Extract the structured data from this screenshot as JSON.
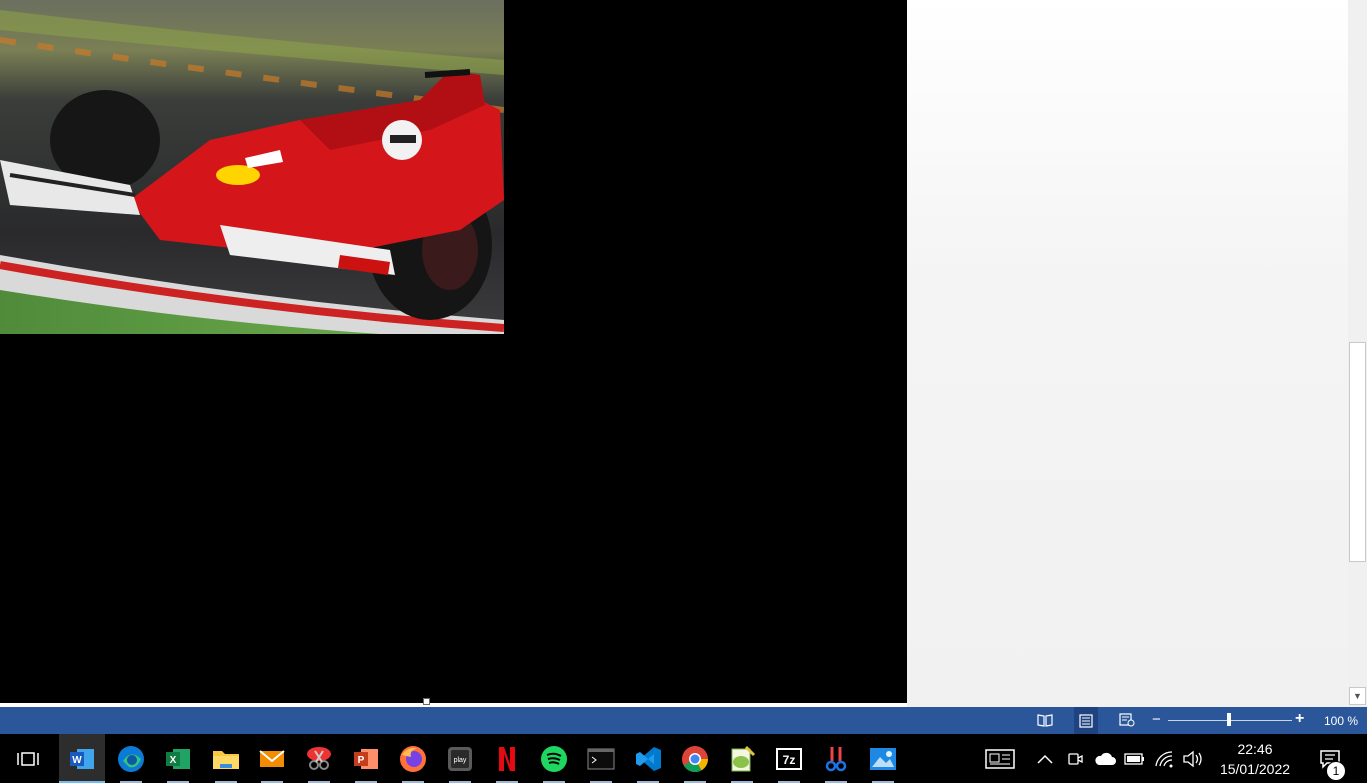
{
  "document": {
    "image_description_name": "f1-car-photo"
  },
  "statusbar": {
    "view_read_mode": "read-mode-icon",
    "view_print_layout": "print-layout-icon",
    "view_web_layout": "web-layout-icon",
    "zoom_level_text": "100 %",
    "zoom_percent": 100,
    "accent": "#2b579a"
  },
  "taskbar": {
    "apps": [
      {
        "name": "task-view-icon"
      },
      {
        "name": "word-icon"
      },
      {
        "name": "edge-icon"
      },
      {
        "name": "excel-icon"
      },
      {
        "name": "file-explorer-icon"
      },
      {
        "name": "mail-icon"
      },
      {
        "name": "snipping-tool-icon"
      },
      {
        "name": "powerpoint-icon"
      },
      {
        "name": "firefox-icon"
      },
      {
        "name": "epic-games-icon"
      },
      {
        "name": "netflix-icon"
      },
      {
        "name": "spotify-icon"
      },
      {
        "name": "terminal-icon"
      },
      {
        "name": "vscode-icon"
      },
      {
        "name": "chrome-icon"
      },
      {
        "name": "notepad-plus-plus-icon"
      },
      {
        "name": "7zip-icon"
      },
      {
        "name": "snip-sketch-icon"
      },
      {
        "name": "photos-icon"
      }
    ],
    "tray": {
      "time": "22:46",
      "date": "15/01/2022",
      "notification_count": "1"
    }
  }
}
